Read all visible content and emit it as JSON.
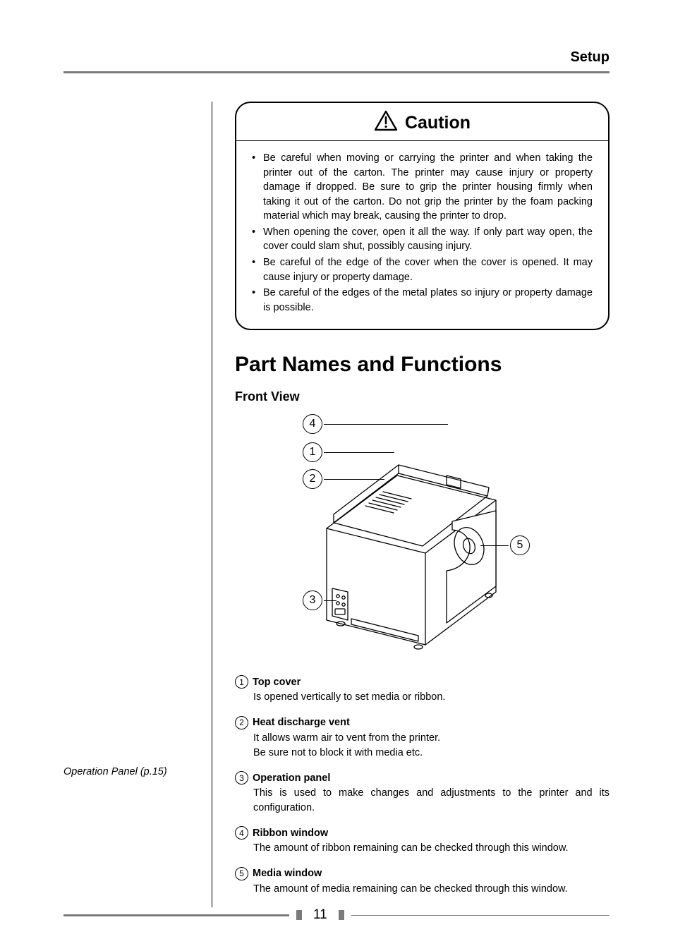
{
  "section_header": "Setup",
  "caution": {
    "title": "Caution",
    "items": [
      "Be careful when moving or carrying the printer and when taking the printer out of the carton. The printer may cause injury or property damage if dropped. Be sure to grip the printer housing firmly when taking it out of the carton. Do not grip the printer by the foam packing material which may break, causing the printer to drop.",
      "When opening the cover, open it all the way. If only part way open, the cover could slam shut, possibly causing injury.",
      "Be careful of the edge of the cover when the cover is opened. It may cause injury or property damage.",
      "Be careful of the edges of the metal plates so injury or property damage is possible."
    ]
  },
  "main_heading": "Part Names and Functions",
  "sub_heading": "Front View",
  "sidenote": "Operation Panel (p.15)",
  "callouts": {
    "c1": "1",
    "c2": "2",
    "c3": "3",
    "c4": "4",
    "c5": "5"
  },
  "defs": [
    {
      "num": "1",
      "title": "Top cover",
      "body": "Is opened vertically to set media or ribbon."
    },
    {
      "num": "2",
      "title": "Heat discharge vent",
      "body": "It allows warm air to vent from the printer.\nBe sure not to block it with media etc."
    },
    {
      "num": "3",
      "title": "Operation panel",
      "body": "This is used to make changes and adjustments to the printer and its configuration."
    },
    {
      "num": "4",
      "title": "Ribbon window",
      "body": "The amount of ribbon remaining can be checked through this window."
    },
    {
      "num": "5",
      "title": "Media window",
      "body": "The amount of media remaining can be checked through this window."
    }
  ],
  "page_number": "11"
}
